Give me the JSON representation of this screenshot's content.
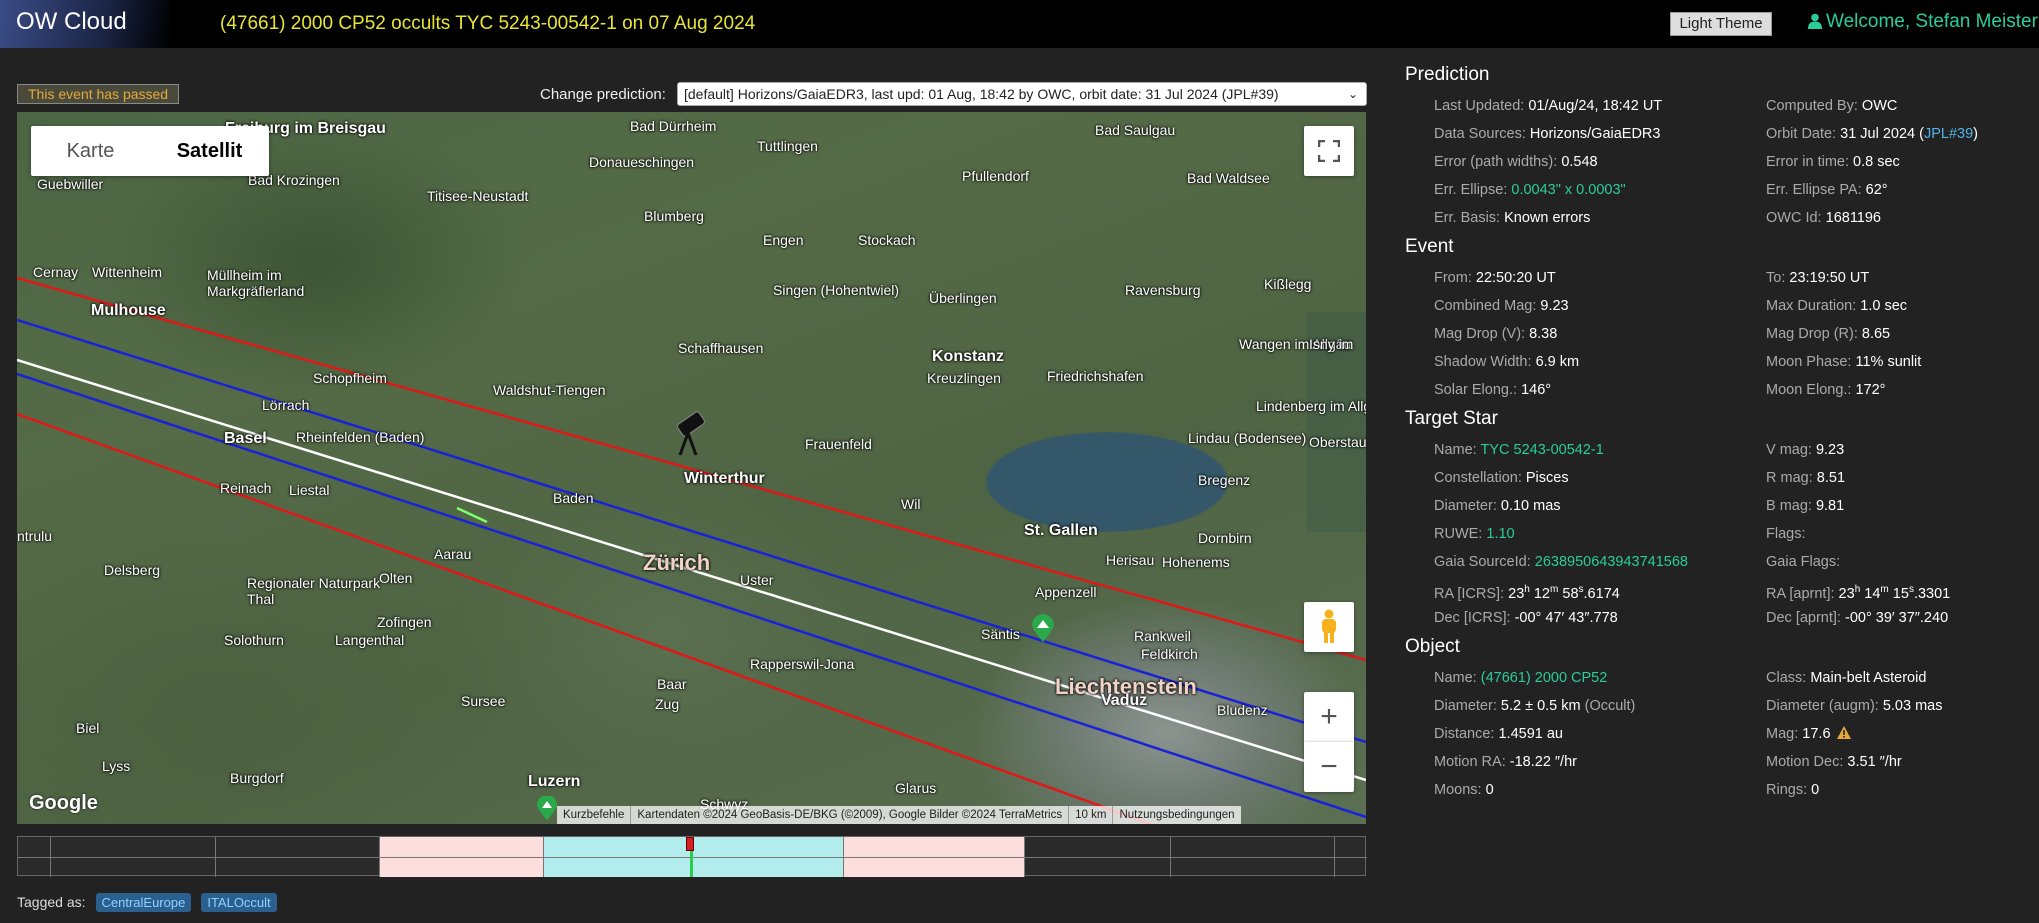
{
  "header": {
    "logo": "OW Cloud",
    "title": "(47661) 2000 CP52 occults TYC 5243-00542-1 on 07 Aug 2024",
    "theme_button": "Light Theme",
    "welcome": "Welcome, Stefan Meister"
  },
  "status": {
    "passed": "This event has passed"
  },
  "prediction_select": {
    "label": "Change prediction:",
    "value": "[default] Horizons/GaiaEDR3, last upd: 01 Aug, 18:42 by OWC, orbit date: 31 Jul 2024 (JPL#39)"
  },
  "map": {
    "type_karte": "Karte",
    "type_satellit": "Satellit",
    "zoom_in": "+",
    "zoom_out": "−",
    "google": "Google",
    "attribution": [
      "Kurzbefehle",
      "Kartendaten ©2024 GeoBasis-DE/BKG (©2009), Google Bilder ©2024 TerraMetrics",
      "10 km",
      "Nutzungsbedingungen"
    ],
    "places": [
      {
        "name": "Freiburg im Breisgau",
        "cls": "med"
      },
      {
        "name": "Bad Dürrheim",
        "cls": ""
      },
      {
        "name": "Tuttlingen",
        "cls": ""
      },
      {
        "name": "Bad Saulgau",
        "cls": ""
      },
      {
        "name": "Donaueschingen",
        "cls": ""
      },
      {
        "name": "Titisee-Neustadt",
        "cls": ""
      },
      {
        "name": "Pfullendorf",
        "cls": ""
      },
      {
        "name": "Bad Waldsee",
        "cls": ""
      },
      {
        "name": "Guebwiller",
        "cls": ""
      },
      {
        "name": "Bad Krozingen",
        "cls": ""
      },
      {
        "name": "Blumberg",
        "cls": ""
      },
      {
        "name": "Engen",
        "cls": ""
      },
      {
        "name": "Stockach",
        "cls": ""
      },
      {
        "name": "Cernay",
        "cls": ""
      },
      {
        "name": "Wittenheim",
        "cls": ""
      },
      {
        "name": "Müllheim im Markgräflerland",
        "cls": ""
      },
      {
        "name": "Singen (Hohentwiel)",
        "cls": ""
      },
      {
        "name": "Überlingen",
        "cls": ""
      },
      {
        "name": "Ravensburg",
        "cls": ""
      },
      {
        "name": "Kißlegg",
        "cls": ""
      },
      {
        "name": "Mulhouse",
        "cls": "med"
      },
      {
        "name": "Schaffhausen",
        "cls": ""
      },
      {
        "name": "Konstanz",
        "cls": "med"
      },
      {
        "name": "Wangen im Allgäu",
        "cls": ""
      },
      {
        "name": "Isny im",
        "cls": ""
      },
      {
        "name": "Schopfheim",
        "cls": ""
      },
      {
        "name": "Kreuzlingen",
        "cls": ""
      },
      {
        "name": "Friedrichshafen",
        "cls": ""
      },
      {
        "name": "Waldshut-Tiengen",
        "cls": ""
      },
      {
        "name": "Lörrach",
        "cls": ""
      },
      {
        "name": "Lindenberg im Allgäu",
        "cls": ""
      },
      {
        "name": "Basel",
        "cls": "med"
      },
      {
        "name": "Rheinfelden (Baden)",
        "cls": ""
      },
      {
        "name": "Frauenfeld",
        "cls": ""
      },
      {
        "name": "Lindau (Bodensee)",
        "cls": ""
      },
      {
        "name": "Oberstau",
        "cls": ""
      },
      {
        "name": "Reinach",
        "cls": ""
      },
      {
        "name": "Liestal",
        "cls": ""
      },
      {
        "name": "Winterthur",
        "cls": "med"
      },
      {
        "name": "Bregenz",
        "cls": ""
      },
      {
        "name": "Baden",
        "cls": ""
      },
      {
        "name": "Wil",
        "cls": ""
      },
      {
        "name": "St. Gallen",
        "cls": "med"
      },
      {
        "name": "Dornbirn",
        "cls": ""
      },
      {
        "name": "Delsberg",
        "cls": ""
      },
      {
        "name": "Aarau",
        "cls": ""
      },
      {
        "name": "Zürich",
        "cls": "big"
      },
      {
        "name": "Uster",
        "cls": ""
      },
      {
        "name": "Herisau",
        "cls": ""
      },
      {
        "name": "Hohenems",
        "cls": ""
      },
      {
        "name": "Regionaler Naturpark Thal",
        "cls": ""
      },
      {
        "name": "Olten",
        "cls": ""
      },
      {
        "name": "Appenzell",
        "cls": ""
      },
      {
        "name": "Säntis",
        "cls": ""
      },
      {
        "name": "Rankweil",
        "cls": ""
      },
      {
        "name": "Zofingen",
        "cls": ""
      },
      {
        "name": "Feldkirch",
        "cls": ""
      },
      {
        "name": "Rapperswil-Jona",
        "cls": ""
      },
      {
        "name": "Liechtenstein",
        "cls": "big"
      },
      {
        "name": "Solothurn",
        "cls": ""
      },
      {
        "name": "Langenthal",
        "cls": ""
      },
      {
        "name": "Baar",
        "cls": ""
      },
      {
        "name": "Zug",
        "cls": ""
      },
      {
        "name": "Vaduz",
        "cls": "med"
      },
      {
        "name": "Bludenz",
        "cls": ""
      },
      {
        "name": "Sursee",
        "cls": ""
      },
      {
        "name": "Biel",
        "cls": ""
      },
      {
        "name": "Lyss",
        "cls": ""
      },
      {
        "name": "Burgdorf",
        "cls": ""
      },
      {
        "name": "Luzern",
        "cls": "med"
      },
      {
        "name": "Glarus",
        "cls": ""
      },
      {
        "name": "Schwyz",
        "cls": ""
      },
      {
        "name": "ntrulu",
        "cls": ""
      }
    ]
  },
  "tags": {
    "label": "Tagged as:",
    "items": [
      "CentralEurope",
      "ITALOccult"
    ]
  },
  "prediction": {
    "title": "Prediction",
    "rows": [
      {
        "k": "Last Updated:",
        "v": "01/Aug/24, 18:42 UT"
      },
      {
        "k": "Computed By:",
        "v": "OWC"
      },
      {
        "k": "Data Sources:",
        "v": "Horizons/GaiaEDR3"
      },
      {
        "k": "Orbit Date:",
        "v": "31 Jul 2024 (",
        "v2": "JPL#39",
        "v3": ")"
      },
      {
        "k": "Error (path widths):",
        "v": "0.548"
      },
      {
        "k": "Error in time:",
        "v": "0.8 sec"
      },
      {
        "k": "Err. Ellipse:",
        "v": "0.0043\" x 0.0003\"",
        "link": true
      },
      {
        "k": "Err. Ellipse PA:",
        "v": "62°"
      },
      {
        "k": "Err. Basis:",
        "v": "Known errors"
      },
      {
        "k": "OWC Id:",
        "v": "1681196"
      }
    ]
  },
  "event": {
    "title": "Event",
    "rows": [
      {
        "k": "From:",
        "v": "22:50:20 UT"
      },
      {
        "k": "To:",
        "v": "23:19:50 UT"
      },
      {
        "k": "Combined Mag:",
        "v": "9.23"
      },
      {
        "k": "Max Duration:",
        "v": "1.0 sec"
      },
      {
        "k": "Mag Drop (V):",
        "v": "8.38"
      },
      {
        "k": "Mag Drop (R):",
        "v": "8.65"
      },
      {
        "k": "Shadow Width:",
        "v": "6.9 km"
      },
      {
        "k": "Moon Phase:",
        "v": "11% sunlit"
      },
      {
        "k": "Solar Elong.:",
        "v": "146°"
      },
      {
        "k": "Moon Elong.:",
        "v": "172°"
      }
    ]
  },
  "target": {
    "title": "Target Star",
    "rows": [
      {
        "k": "Name:",
        "v": "TYC 5243-00542-1",
        "link": true
      },
      {
        "k": "V mag:",
        "v": "9.23"
      },
      {
        "k": "Constellation:",
        "v": "Pisces"
      },
      {
        "k": "R mag:",
        "v": "8.51"
      },
      {
        "k": "Diameter:",
        "v": "0.10 mas"
      },
      {
        "k": "B mag:",
        "v": "9.81"
      },
      {
        "k": "RUWE:",
        "v": "1.10",
        "link": true
      },
      {
        "k": "Flags:",
        "v": ""
      },
      {
        "k": "Gaia SourceId:",
        "v": "2638950643943741568",
        "link": true
      },
      {
        "k": "Gaia Flags:",
        "v": ""
      },
      {
        "k": "RA [ICRS]:",
        "ra": [
          "23",
          "h",
          " 12",
          "m",
          " 58",
          "s",
          ".6174"
        ]
      },
      {
        "k": "RA [aprnt]:",
        "ra": [
          "23",
          "h",
          " 14",
          "m",
          " 15",
          "s",
          ".3301"
        ]
      },
      {
        "k": "Dec [ICRS]:",
        "v": "-00° 47′ 43″.778"
      },
      {
        "k": "Dec [aprnt]:",
        "v": "-00° 39′ 37″.240"
      }
    ]
  },
  "object": {
    "title": "Object",
    "rows": [
      {
        "k": "Name:",
        "v": "(47661) 2000 CP52",
        "link": true
      },
      {
        "k": "Class:",
        "v": "Main-belt Asteroid"
      },
      {
        "k": "Diameter:",
        "v": "5.2 ± 0.5 km",
        "v2": "(Occult)"
      },
      {
        "k": "Diameter (augm):",
        "v": "5.03 mas"
      },
      {
        "k": "Distance:",
        "v": "1.4591 au"
      },
      {
        "k": "Mag:",
        "v": "17.6",
        "warn": true
      },
      {
        "k": "Motion RA:",
        "v": "-18.22 ″/hr"
      },
      {
        "k": "Motion Dec:",
        "v": "3.51 ″/hr"
      },
      {
        "k": "Moons:",
        "v": "0"
      },
      {
        "k": "Rings:",
        "v": "0"
      }
    ]
  },
  "colors": {
    "accent": "#2bcc9a",
    "title": "#e8e632",
    "passed": "#e5a93b",
    "path_center": "#ffffff",
    "path_blue": "#1a22d8",
    "path_red": "#e01818"
  }
}
